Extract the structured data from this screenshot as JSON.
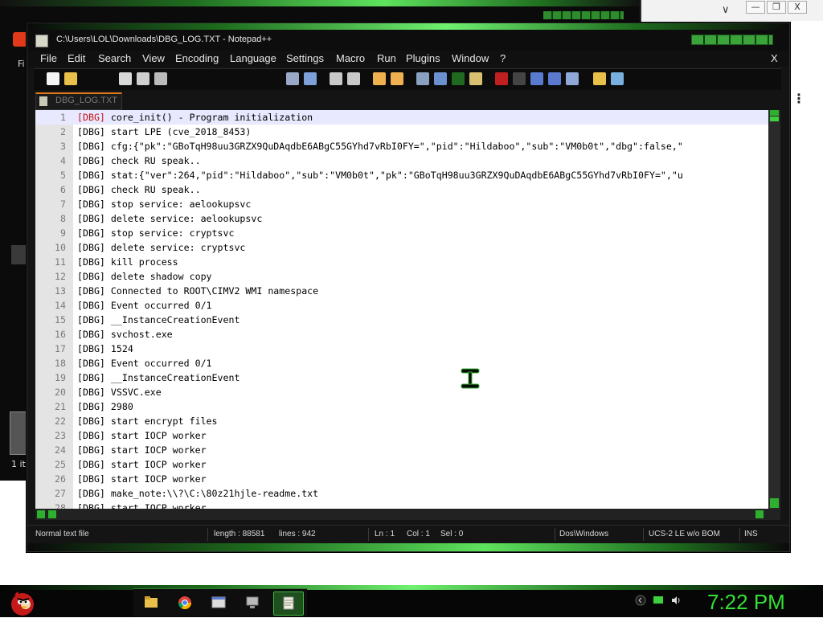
{
  "background_window": {
    "file_label": "Fi",
    "item_count": "1 ite",
    "chrome_min": "—",
    "chrome_max": "❐",
    "chrome_close": "X",
    "chevron": "∨",
    "kebab": "⋮"
  },
  "window": {
    "title": "C:\\Users\\LOL\\Downloads\\DBG_LOG.TXT - Notepad++",
    "close_label": "X"
  },
  "menu": {
    "items": [
      "File",
      "Edit",
      "Search",
      "View",
      "Encoding",
      "Language",
      "Settings",
      "Macro",
      "Run",
      "Plugins",
      "Window",
      "?"
    ]
  },
  "tab": {
    "label": "DBG_LOG.TXT"
  },
  "editor": {
    "current_line": 1,
    "lines": [
      {
        "n": "1",
        "text": " core_init() - Program initialization"
      },
      {
        "n": "2",
        "text": " start LPE (cve_2018_8453)"
      },
      {
        "n": "3",
        "text": " cfg:{\"pk\":\"GBoTqH98uu3GRZX9QuDAqdbE6ABgC55GYhd7vRbI0FY=\",\"pid\":\"Hildaboo\",\"sub\":\"VM0b0t\",\"dbg\":false,\""
      },
      {
        "n": "4",
        "text": " check RU speak.."
      },
      {
        "n": "5",
        "text": " stat:{\"ver\":264,\"pid\":\"Hildaboo\",\"sub\":\"VM0b0t\",\"pk\":\"GBoTqH98uu3GRZX9QuDAqdbE6ABgC55GYhd7vRbI0FY=\",\"u"
      },
      {
        "n": "6",
        "text": " check RU speak.."
      },
      {
        "n": "7",
        "text": " stop service: aelookupsvc"
      },
      {
        "n": "8",
        "text": " delete service: aelookupsvc"
      },
      {
        "n": "9",
        "text": " stop service: cryptsvc"
      },
      {
        "n": "10",
        "text": " delete service: cryptsvc"
      },
      {
        "n": "11",
        "text": " kill process"
      },
      {
        "n": "12",
        "text": " delete shadow copy"
      },
      {
        "n": "13",
        "text": " Connected to ROOT\\CIMV2 WMI namespace"
      },
      {
        "n": "14",
        "text": " Event occurred 0/1"
      },
      {
        "n": "15",
        "text": " __InstanceCreationEvent"
      },
      {
        "n": "16",
        "text": " svchost.exe"
      },
      {
        "n": "17",
        "text": " 1524"
      },
      {
        "n": "18",
        "text": " Event occurred 0/1"
      },
      {
        "n": "19",
        "text": " __InstanceCreationEvent"
      },
      {
        "n": "20",
        "text": " VSSVC.exe"
      },
      {
        "n": "21",
        "text": " 2980"
      },
      {
        "n": "22",
        "text": " start encrypt files"
      },
      {
        "n": "23",
        "text": " start IOCP worker"
      },
      {
        "n": "24",
        "text": " start IOCP worker"
      },
      {
        "n": "25",
        "text": " start IOCP worker"
      },
      {
        "n": "26",
        "text": " start IOCP worker"
      },
      {
        "n": "27",
        "text": " make_note:\\\\?\\C:\\80z21hjle-readme.txt"
      },
      {
        "n": "28",
        "text": " start IOCP worker"
      }
    ],
    "tag": "[DBG]"
  },
  "statusbar": {
    "file_type": "Normal text file",
    "length": "length : 88581",
    "lines": "lines : 942",
    "ln": "Ln : 1",
    "col": "Col : 1",
    "sel": "Sel : 0",
    "eol": "Dos\\Windows",
    "encoding": "UCS-2 LE w/o BOM",
    "mode": "INS"
  },
  "taskbar": {
    "clock": "7:22 PM",
    "icons": [
      "file-explorer-icon",
      "chrome-icon",
      "window-icon",
      "network-computer-icon",
      "notepad-plus-plus-icon"
    ]
  },
  "colors": {
    "accent_green": "#34e034",
    "tag_red": "#c01010",
    "tab_orange": "#e07a1a"
  }
}
